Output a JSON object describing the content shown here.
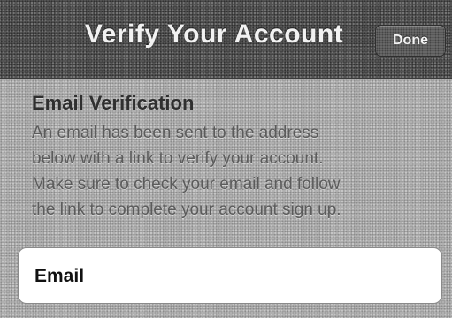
{
  "nav_bar": {
    "title": "Verify Your Account",
    "done_label": "Done"
  },
  "email_verification": {
    "heading": "Email Verification",
    "lines": [
      "An email has been sent to the address",
      "below with a link to verify your account.",
      "Make sure to check your email and follow",
      "the link to complete your account sign up."
    ]
  },
  "email_field": {
    "label": "Email",
    "value": ""
  }
}
